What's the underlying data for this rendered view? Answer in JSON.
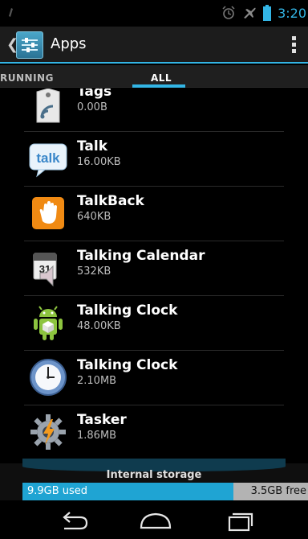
{
  "status_bar": {
    "time": "3:20",
    "icons": [
      "usb-debug-icon",
      "alarm-icon",
      "airplane-mode-icon",
      "battery-icon"
    ],
    "accent": "#33b5e5"
  },
  "action_bar": {
    "title": "Apps",
    "icon": "settings-sliders-icon",
    "accent": "#33b5e5"
  },
  "tabs": [
    {
      "label": "RUNNING",
      "selected": false
    },
    {
      "label": "ALL",
      "selected": true
    }
  ],
  "apps": [
    {
      "name": "Tags",
      "size": "0.00B",
      "icon": "tags-nfc-icon"
    },
    {
      "name": "Talk",
      "size": "16.00KB",
      "icon": "talk-icon"
    },
    {
      "name": "TalkBack",
      "size": "640KB",
      "icon": "talkback-hand-icon"
    },
    {
      "name": "Talking Calendar",
      "size": "532KB",
      "icon": "talking-calendar-icon"
    },
    {
      "name": "Talking Clock",
      "size": "48.00KB",
      "icon": "android-robot-icon"
    },
    {
      "name": "Talking Clock",
      "size": "2.10MB",
      "icon": "clock-icon"
    },
    {
      "name": "Tasker",
      "size": "1.86MB",
      "icon": "tasker-gear-icon"
    }
  ],
  "storage": {
    "label": "Internal storage",
    "used": "9.9GB used",
    "free": "3.5GB free",
    "used_fraction": 0.74
  },
  "nav": {
    "icons": [
      "back-icon",
      "home-icon",
      "recent-apps-icon"
    ]
  }
}
